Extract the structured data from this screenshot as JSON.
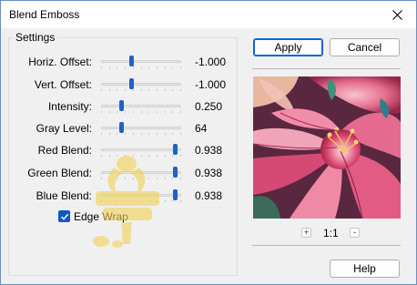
{
  "window": {
    "title": "Blend Emboss",
    "close_icon": "close-icon"
  },
  "settings": {
    "group_label": "Settings",
    "sliders": [
      {
        "label": "Horiz. Offset:",
        "value": "-1.000",
        "fraction": 0.38
      },
      {
        "label": "Vert. Offset:",
        "value": "-1.000",
        "fraction": 0.38
      },
      {
        "label": "Intensity:",
        "value": "0.250",
        "fraction": 0.25
      },
      {
        "label": "Gray Level:",
        "value": "64",
        "fraction": 0.25
      },
      {
        "label": "Red Blend:",
        "value": "0.938",
        "fraction": 0.92
      },
      {
        "label": "Green Blend:",
        "value": "0.938",
        "fraction": 0.92
      },
      {
        "label": "Blue Blend:",
        "value": "0.938",
        "fraction": 0.92
      }
    ],
    "edge_wrap": {
      "label": "Edge Wrap",
      "checked": true
    }
  },
  "buttons": {
    "apply": "Apply",
    "cancel": "Cancel",
    "help": "Help"
  },
  "preview": {
    "zoom_in": "+",
    "zoom_level": "1:1",
    "zoom_out": "-"
  },
  "colors": {
    "accent": "#0c5bc8",
    "slider_thumb": "#1f62c4",
    "default_button_border": "#0d67d6"
  }
}
